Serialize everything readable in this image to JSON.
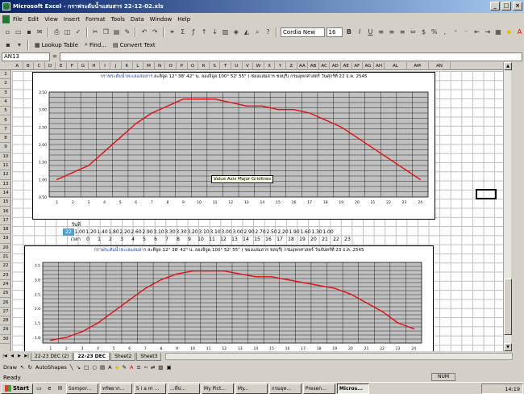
{
  "window": {
    "title": "Microsoft Excel - กราฟระดับน้ำแสมสาร 22-12-02.xls"
  },
  "menu": [
    "File",
    "Edit",
    "View",
    "Insert",
    "Format",
    "Tools",
    "Data",
    "Window",
    "Help"
  ],
  "toolbar": {
    "font_name": "Cordia New",
    "font_size": "16",
    "lookup_table": "Lookup Table",
    "find": "Find...",
    "convert_text": "Convert Text"
  },
  "formula_bar": {
    "name_box": "AN13",
    "fx": "="
  },
  "columns": [
    "A",
    "B",
    "C",
    "D",
    "E",
    "F",
    "G",
    "H",
    "I",
    "J",
    "K",
    "L",
    "M",
    "N",
    "O",
    "P",
    "Q",
    "R",
    "S",
    "T",
    "U",
    "V",
    "W",
    "X",
    "Y",
    "Z",
    "AA",
    "AB",
    "AC",
    "AD",
    "AE",
    "AF",
    "AG",
    "AH",
    "AL",
    "AM",
    "AN"
  ],
  "rows": [
    "1",
    "2",
    "3",
    "4",
    "5",
    "6",
    "7",
    "8",
    "9",
    "10",
    "11",
    "12",
    "13",
    "14",
    "15",
    "16",
    "17",
    "18",
    "19",
    "20",
    "21",
    "22",
    "23",
    "24",
    "25",
    "26",
    "27",
    "28",
    "29",
    "30"
  ],
  "chart1": {
    "title_blue": "กราฟระดับน้ำทะเลแสมสาร",
    "title_rest": "ละติจูด 12° 38' 42\" น. ลองจิจูด 100° 52' 55\" ( ช่องแสมสาร ชลบุรี) กรมอุทกศาสตร์ วันศุกร์ที่ 22 ธ.ค. 2545"
  },
  "chart2": {
    "title_blue": "กราฟระดับน้ำทะเลแสมสาร",
    "title_rest": "ละติจูด 12° 38' 42\" น. ลองจิจูด 100° 52' 55\" ( ช่องแสมสาร ชลบุรี) กรมอุทกศาสตร์ วันจันทร์ที่ 23 ธ.ค. 2545"
  },
  "tooltip": "Value Axis Major Gridlines",
  "data_table": {
    "label_day": "วันที่",
    "label_level": "ระดับ",
    "label_time": "เวลา",
    "sel_value": "22",
    "levels": [
      "1.00",
      "1.20",
      "1.40",
      "1.80",
      "2.20",
      "2.60",
      "2.90",
      "3.10",
      "3.30",
      "3.30",
      "3.20",
      "3.10",
      "3.10",
      "3.00",
      "3.00",
      "2.90",
      "2.70",
      "2.50",
      "2.20",
      "1.90",
      "1.60",
      "1.30",
      "1.00"
    ],
    "times": [
      "0",
      "1",
      "2",
      "3",
      "4",
      "5",
      "6",
      "7",
      "8",
      "9",
      "10",
      "11",
      "12",
      "13",
      "14",
      "15",
      "16",
      "17",
      "18",
      "19",
      "20",
      "21",
      "22",
      "23"
    ]
  },
  "chart_data": [
    {
      "type": "line",
      "title": "กราฟระดับน้ำทะเลแสมสาร ละติจูด 12° 38' 42\" น. ลองจิจูด 100° 52' 55\" ( ช่องแสมสาร ชลบุรี) กรมอุทกศาสตร์ วันศุกร์ที่ 22 ธ.ค. 2545",
      "x": [
        1,
        2,
        3,
        4,
        5,
        6,
        7,
        8,
        9,
        10,
        11,
        12,
        13,
        14,
        15,
        16,
        17,
        18,
        19,
        20,
        21,
        22,
        23,
        24
      ],
      "values": [
        1.0,
        1.2,
        1.4,
        1.8,
        2.2,
        2.6,
        2.9,
        3.1,
        3.3,
        3.3,
        3.3,
        3.2,
        3.1,
        3.1,
        3.0,
        3.0,
        2.9,
        2.7,
        2.5,
        2.2,
        1.9,
        1.6,
        1.3,
        1.0
      ],
      "y_ticks": [
        "0.50",
        "1.00",
        "1.50",
        "2.00",
        "2.50",
        "3.00",
        "3.50"
      ],
      "ylim": [
        0.5,
        3.5
      ],
      "color": "#e01010",
      "grid": true
    },
    {
      "type": "line",
      "title": "กราฟระดับน้ำทะเลแสมสาร ละติจูด 12° 38' 42\" น. ลองจิจูด 100° 52' 55\" ( ช่องแสมสาร ชลบุรี) กรมอุทกศาสตร์ วันจันทร์ที่ 23 ธ.ค. 2545",
      "x": [
        1,
        2,
        3,
        4,
        5,
        6,
        7,
        8,
        9,
        10,
        11,
        12,
        13,
        14,
        15,
        16,
        17,
        18,
        19,
        20,
        21,
        22,
        23,
        24
      ],
      "values": [
        0.9,
        1.0,
        1.2,
        1.5,
        1.9,
        2.3,
        2.7,
        3.0,
        3.2,
        3.3,
        3.3,
        3.3,
        3.2,
        3.1,
        3.1,
        3.0,
        2.9,
        2.8,
        2.7,
        2.5,
        2.2,
        1.9,
        1.5,
        1.3
      ],
      "y_ticks": [
        "1.0",
        "1.5",
        "2.0",
        "2.5",
        "3.0",
        "3.5"
      ],
      "ylim": [
        0.8,
        3.6
      ],
      "color": "#e01010",
      "grid": true
    }
  ],
  "sheet_tabs": [
    "22-23 DEC (2)",
    "22-23 DEC",
    "Sheet2",
    "Sheet3"
  ],
  "active_tab": 1,
  "drawbar": {
    "draw": "Draw",
    "autoshapes": "AutoShapes"
  },
  "status": {
    "text": "Ready",
    "num": "NUM"
  },
  "taskbar": {
    "start": "Start",
    "buttons": [
      "Sompor...",
      "ทรัพยาก...",
      "S i a m ...",
      "...ที่ป...",
      "My Pict...",
      "My...",
      "กรมอุท...",
      "Presen...",
      "Micros..."
    ],
    "active": 8,
    "clock": "14:19"
  }
}
